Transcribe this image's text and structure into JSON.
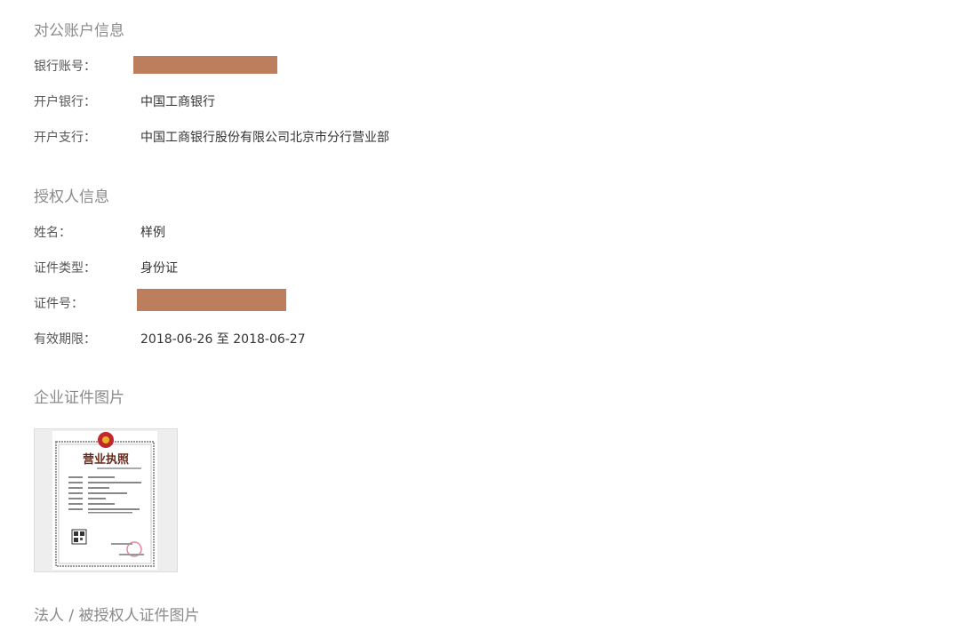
{
  "account": {
    "title": "对公账户信息",
    "rows": [
      {
        "label": "银行账号：",
        "value": ""
      },
      {
        "label": "开户银行：",
        "value": "中国工商银行"
      },
      {
        "label": "开户支行：",
        "value": "中国工商银行股份有限公司北京市分行营业部"
      }
    ]
  },
  "authorized": {
    "title": "授权人信息",
    "rows": [
      {
        "label": "姓名：",
        "value": "样例"
      },
      {
        "label": "证件类型：",
        "value": "身份证"
      },
      {
        "label": "证件号：",
        "value": ""
      },
      {
        "label": "有效期限：",
        "value": "2018-06-26 至 2018-06-27"
      }
    ]
  },
  "enterprise_images": {
    "title": "企业证件图片",
    "thumbnail": {
      "cert_title": "营业执照",
      "redaction_color": "#bc7e5c"
    }
  },
  "legal_images": {
    "title": "法人 / 被授权人证件图片"
  }
}
